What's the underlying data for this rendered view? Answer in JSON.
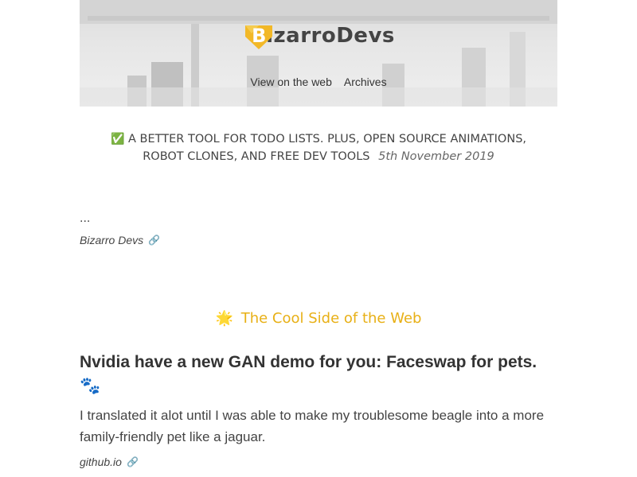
{
  "header": {
    "brand_b": "B",
    "brand_rest": "izarroDevs",
    "nav": [
      {
        "label": "View on the web"
      },
      {
        "label": "Archives"
      }
    ]
  },
  "issue": {
    "icon": "✅",
    "title": "A BETTER TOOL FOR TODO LISTS. PLUS, OPEN SOURCE ANIMATIONS, ROBOT CLONES, AND FREE DEV TOOLS",
    "date": "5th November 2019"
  },
  "intro": {
    "text": "...",
    "source": "Bizarro Devs",
    "link_icon": "🔗"
  },
  "section": {
    "icon": "🌟",
    "title": "The Cool Side of the Web"
  },
  "article": {
    "title": "Nvidia have a new GAN demo for you: Faceswap for pets. 🐾",
    "description": "I translated it alot until I was able to make my troublesome beagle into a more family-friendly pet like a jaguar.",
    "source": "github.io",
    "link_icon": "🔗"
  },
  "colors": {
    "accent": "#e8b016",
    "text": "#333333"
  }
}
